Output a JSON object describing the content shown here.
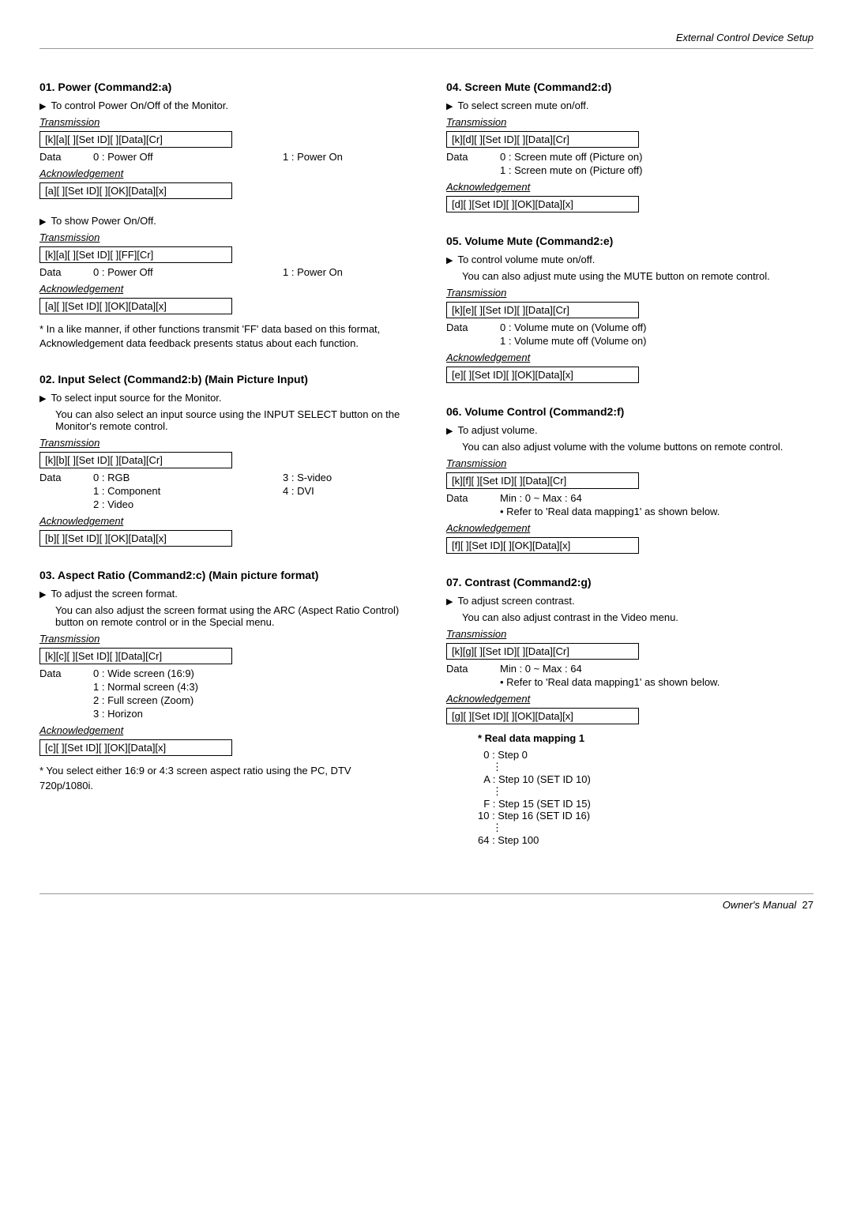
{
  "header": {
    "title": "External Control Device Setup"
  },
  "footer": {
    "label": "Owner's Manual",
    "page": "27"
  },
  "left": {
    "s01": {
      "title": "01. Power (Command2:a)",
      "desc1": "To control Power On/Off of the Monitor.",
      "trans": "Transmission",
      "cmd1": "[k][a][  ][Set ID][  ][Data][Cr]",
      "dlabel": "Data",
      "d0": "0  :  Power Off",
      "d1": "1  :  Power On",
      "ack": "Acknowledgement",
      "ackcmd": "[a][  ][Set ID][  ][OK][Data][x]",
      "desc2": "To show Power On/Off.",
      "cmd2": "[k][a][  ][Set ID][  ][FF][Cr]",
      "d0b": "0  :  Power Off",
      "d1b": "1  :  Power On",
      "ackcmd2": "[a][  ][Set ID][  ][OK][Data][x]",
      "note": "* In a like manner, if other functions transmit 'FF' data based on this format, Acknowledgement data feedback presents status about each function."
    },
    "s02": {
      "title": "02. Input Select (Command2:b) (Main Picture Input)",
      "desc1": "To select input source for the Monitor.",
      "desc2": "You can also select an input source using the INPUT SELECT button on the Monitor's remote control.",
      "trans": "Transmission",
      "cmd": "[k][b][  ][Set ID][  ][Data][Cr]",
      "dlabel": "Data",
      "d0": "0  :  RGB",
      "d1": "1  :  Component",
      "d2": "2  :  Video",
      "d3": "3  :  S-video",
      "d4": "4  :  DVI",
      "ack": "Acknowledgement",
      "ackcmd": "[b][  ][Set ID][  ][OK][Data][x]"
    },
    "s03": {
      "title": "03. Aspect Ratio (Command2:c) (Main picture format)",
      "desc1": "To adjust the screen format.",
      "desc2": "You can also adjust the screen format using the ARC (Aspect Ratio Control) button on remote control or in the Special menu.",
      "trans": "Transmission",
      "cmd": "[k][c][  ][Set ID][  ][Data][Cr]",
      "dlabel": "Data",
      "d0": "0  :   Wide screen (16:9)",
      "d1": "1  :   Normal screen (4:3)",
      "d2": "2  :   Full screen (Zoom)",
      "d3": "3  :   Horizon",
      "ack": "Acknowledgement",
      "ackcmd": "[c][  ][Set ID][  ][OK][Data][x]",
      "note": "* You select either 16:9 or 4:3 screen aspect ratio using the PC, DTV 720p/1080i."
    }
  },
  "right": {
    "s04": {
      "title": "04. Screen Mute (Command2:d)",
      "desc": "To select screen mute on/off.",
      "trans": "Transmission",
      "cmd": "[k][d][  ][Set ID][  ][Data][Cr]",
      "dlabel": "Data",
      "d0": "0  :   Screen mute off (Picture on)",
      "d1": "1  :   Screen mute on (Picture off)",
      "ack": "Acknowledgement",
      "ackcmd": "[d][  ][Set ID][  ][OK][Data][x]"
    },
    "s05": {
      "title": "05. Volume Mute (Command2:e)",
      "desc1": "To control volume mute on/off.",
      "desc2": "You can also adjust mute using the MUTE button on remote control.",
      "trans": "Transmission",
      "cmd": "[k][e][  ][Set ID][  ][Data][Cr]",
      "dlabel": "Data",
      "d0": "0  :   Volume mute on (Volume off)",
      "d1": "1  :   Volume mute off (Volume on)",
      "ack": "Acknowledgement",
      "ackcmd": "[e][  ][Set ID][  ][OK][Data][x]"
    },
    "s06": {
      "title": "06. Volume Control (Command2:f)",
      "desc1": "To adjust volume.",
      "desc2": "You can also adjust volume with the volume buttons on remote control.",
      "trans": "Transmission",
      "cmd": "[k][f][  ][Set ID][  ][Data][Cr]",
      "dlabel": "Data",
      "range": "Min : 0 ~ Max : 64",
      "refer": "• Refer to 'Real data mapping1' as shown below.",
      "ack": "Acknowledgement",
      "ackcmd": "[f][  ][Set ID][  ][OK][Data][x]"
    },
    "s07": {
      "title": "07. Contrast (Command2:g)",
      "desc1": "To adjust screen contrast.",
      "desc2": "You can also adjust contrast in the Video menu.",
      "trans": "Transmission",
      "cmd": "[k][g][  ][Set ID][  ][Data][Cr]",
      "dlabel": "Data",
      "range": "Min : 0 ~ Max : 64",
      "refer": "• Refer to 'Real data mapping1' as shown below.",
      "ack": "Acknowledgement",
      "ackcmd": "[g][  ][Set ID][  ][OK][Data][x]"
    },
    "mapping": {
      "title": "*  Real data mapping 1",
      "r0": "0  : Step 0",
      "rA": "A  : Step 10 (SET ID 10)",
      "rF": "F  : Step 15 (SET ID 15)",
      "r10": "10  : Step 16 (SET ID 16)",
      "r64": "64  : Step 100"
    }
  }
}
